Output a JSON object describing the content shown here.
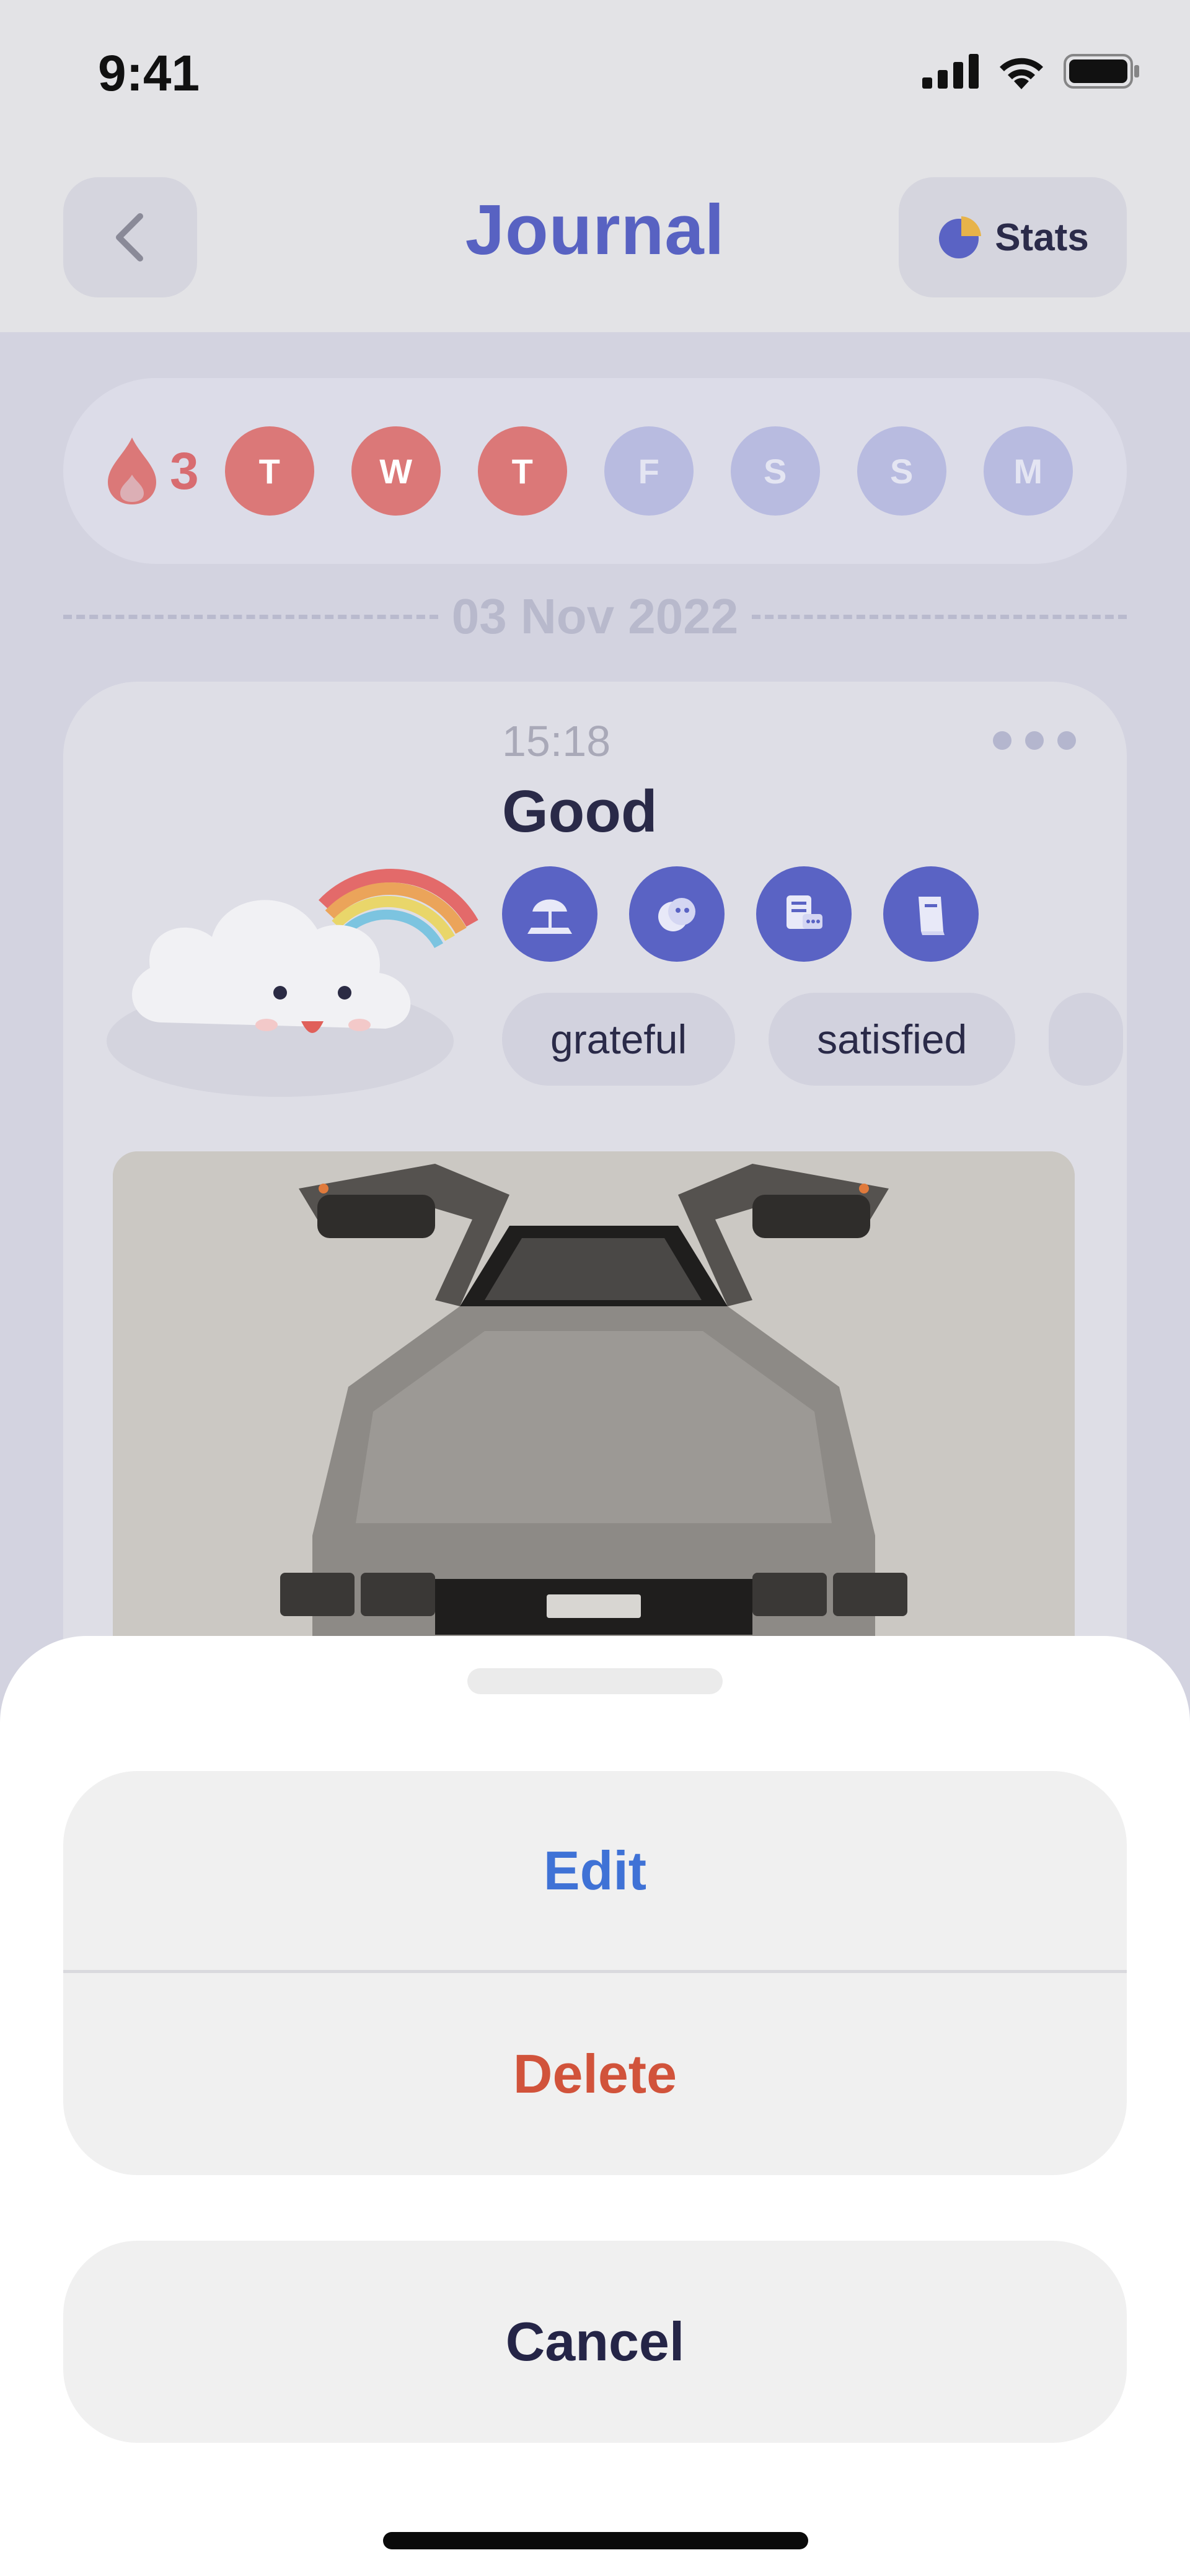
{
  "status_bar": {
    "time": "9:41"
  },
  "header": {
    "title": "Journal",
    "stats_label": "Stats"
  },
  "streak": {
    "count": "3",
    "days": [
      {
        "label": "T",
        "done": true
      },
      {
        "label": "W",
        "done": true
      },
      {
        "label": "T",
        "done": true
      },
      {
        "label": "F",
        "done": false
      },
      {
        "label": "S",
        "done": false
      },
      {
        "label": "S",
        "done": false
      },
      {
        "label": "M",
        "done": false
      }
    ]
  },
  "entry": {
    "date": "03 Nov 2022",
    "time": "15:18",
    "mood": "Good",
    "activities": [
      "beach-umbrella-icon",
      "face-mask-icon",
      "chat-device-icon",
      "book-icon"
    ],
    "feelings": [
      "grateful",
      "satisfied"
    ]
  },
  "action_sheet": {
    "edit_label": "Edit",
    "delete_label": "Delete",
    "cancel_label": "Cancel"
  },
  "colors": {
    "accent": "#5862c2",
    "streak_done": "#db7878",
    "edit": "#3f72d6",
    "delete": "#d1533b"
  }
}
